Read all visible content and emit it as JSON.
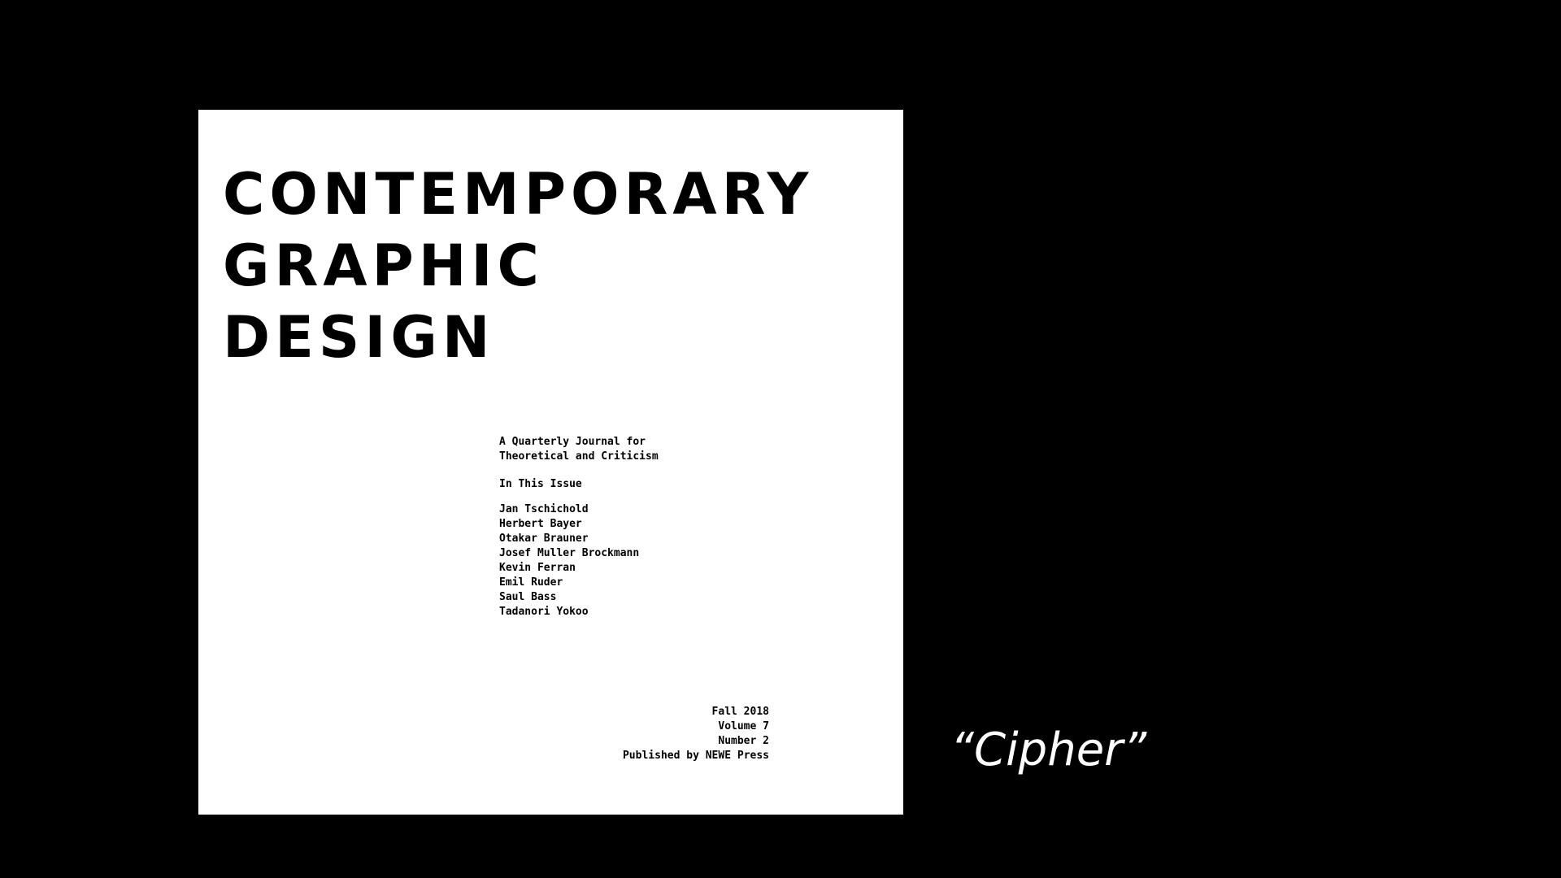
{
  "poster": {
    "title_lines": [
      "CONTEMPORARY",
      "GRAPHIC",
      "DESIGN"
    ],
    "intro_lines": [
      "A Quarterly Journal for",
      "Theoretical and Criticism"
    ],
    "issue_label": "In This Issue",
    "contributors": [
      "Jan Tschichold",
      "Herbert Bayer",
      "Otakar Brauner",
      "Josef Muller Brockmann",
      "Kevin Ferran",
      "Emil Ruder",
      "Saul Bass",
      "Tadanori Yokoo"
    ],
    "footer_lines": [
      "Fall 2018",
      "Volume 7",
      "Number 2",
      "Published by NEWE Press"
    ]
  },
  "caption": "“Cipher”"
}
